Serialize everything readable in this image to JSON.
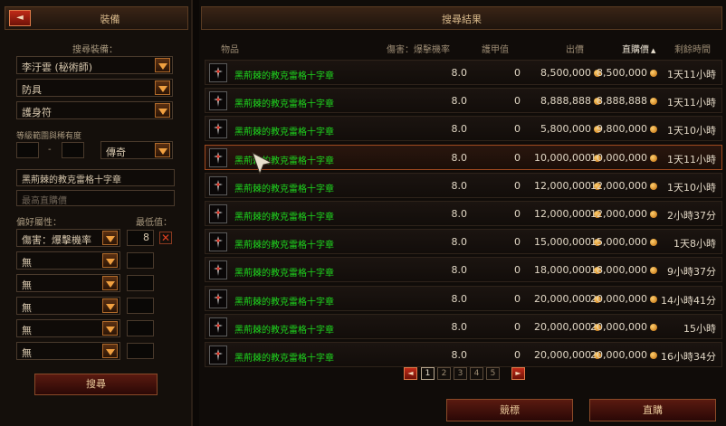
{
  "left": {
    "title": "裝備",
    "back_icon": "◄",
    "search_items_label": "搜尋裝備：",
    "class_select": "李汙雲 (秘術師)",
    "type_select": "防具",
    "subtype_select": "護身符",
    "level_rarity_label": "等級範圍與稀有度",
    "level_dash": "-",
    "rarity_select": "傳奇",
    "name_value": "黑荊棘的教克雷格十字章",
    "buyout_placeholder": "最高直購價",
    "pref_label": "偏好屬性：",
    "min_label": "最低值：",
    "stats": [
      {
        "value": "傷害：爆擊機率",
        "min": "8",
        "clear_icon": "✕"
      },
      {
        "value": "無",
        "min": ""
      },
      {
        "value": "無",
        "min": ""
      },
      {
        "value": "無",
        "min": ""
      },
      {
        "value": "無",
        "min": ""
      },
      {
        "value": "無",
        "min": ""
      }
    ],
    "search_button": "搜尋"
  },
  "right": {
    "title": "搜尋結果",
    "columns": {
      "item": "物品",
      "dps": "傷害：爆擊機率",
      "armor": "護甲值",
      "bid": "出價",
      "buyout": "直購價",
      "sort_indicator": "▲",
      "time": "剩餘時間"
    },
    "rows": [
      {
        "name": "黑荊棘的教克雷格十字章",
        "dps": "8.0",
        "armor": "0",
        "bid": "8,500,000",
        "buyout": "8,500,000",
        "time": "1天11小時"
      },
      {
        "name": "黑荊棘的教克雷格十字章",
        "dps": "8.0",
        "armor": "0",
        "bid": "8,888,888",
        "buyout": "8,888,888",
        "time": "1天11小時"
      },
      {
        "name": "黑荊棘的教克雷格十字章",
        "dps": "8.0",
        "armor": "0",
        "bid": "5,800,000",
        "buyout": "9,800,000",
        "time": "1天10小時"
      },
      {
        "name": "黑荊棘的教克雷格十字章",
        "dps": "8.0",
        "armor": "0",
        "bid": "10,000,000",
        "buyout": "10,000,000",
        "time": "1天11小時"
      },
      {
        "name": "黑荊棘的教克雷格十字章",
        "dps": "8.0",
        "armor": "0",
        "bid": "12,000,000",
        "buyout": "12,000,000",
        "time": "1天10小時"
      },
      {
        "name": "黑荊棘的教克雷格十字章",
        "dps": "8.0",
        "armor": "0",
        "bid": "12,000,000",
        "buyout": "12,000,000",
        "time": "2小時37分"
      },
      {
        "name": "黑荊棘的教克雷格十字章",
        "dps": "8.0",
        "armor": "0",
        "bid": "15,000,000",
        "buyout": "15,000,000",
        "time": "1天8小時"
      },
      {
        "name": "黑荊棘的教克雷格十字章",
        "dps": "8.0",
        "armor": "0",
        "bid": "18,000,000",
        "buyout": "18,000,000",
        "time": "9小時37分"
      },
      {
        "name": "黑荊棘的教克雷格十字章",
        "dps": "8.0",
        "armor": "0",
        "bid": "20,000,000",
        "buyout": "20,000,000",
        "time": "14小時41分"
      },
      {
        "name": "黑荊棘的教克雷格十字章",
        "dps": "8.0",
        "armor": "0",
        "bid": "20,000,000",
        "buyout": "20,000,000",
        "time": "15小時"
      },
      {
        "name": "黑荊棘的教克雷格十字章",
        "dps": "8.0",
        "armor": "0",
        "bid": "20,000,000",
        "buyout": "20,000,000",
        "time": "16小時34分"
      }
    ],
    "selected_row": 3,
    "pager": {
      "prev": "◄",
      "pages": [
        "1",
        "2",
        "3",
        "4",
        "5"
      ],
      "current": "1",
      "next": "►"
    },
    "bid_button": "競標",
    "buyout_button": "直購"
  },
  "colors": {
    "item_name": "#1ed81e",
    "accent_red": "#c02a18",
    "gold": "#f0a040"
  }
}
